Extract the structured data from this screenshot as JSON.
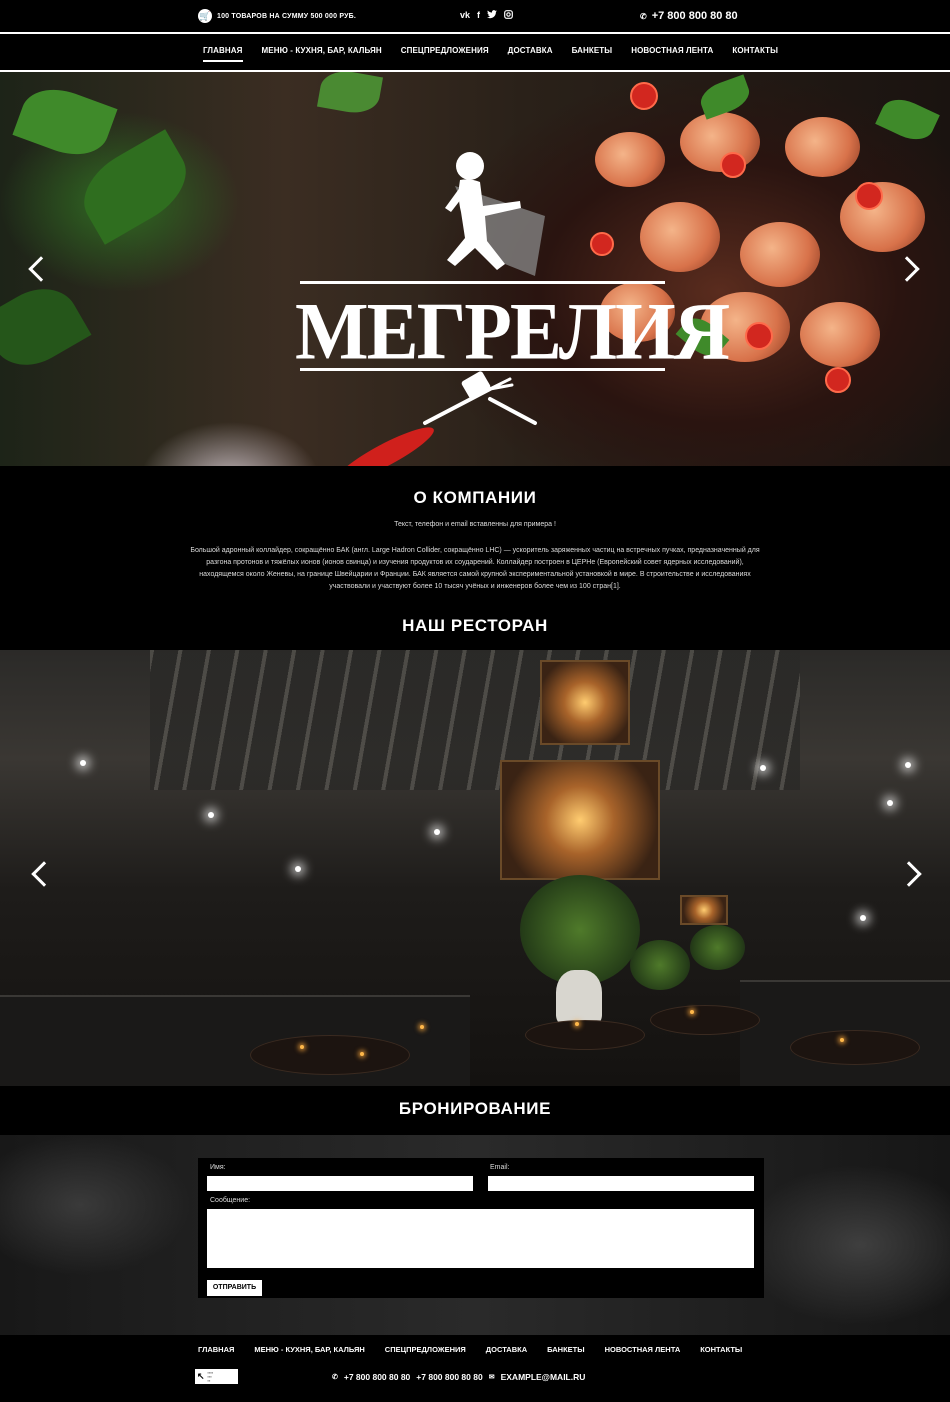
{
  "topbar": {
    "cart_text": "100 товаров на сумму 500 000 руб.",
    "socials": [
      {
        "icon": "vk-icon",
        "glyph": "vk"
      },
      {
        "icon": "facebook-icon",
        "glyph": "f"
      },
      {
        "icon": "twitter-icon",
        "glyph": "t"
      },
      {
        "icon": "instagram-icon",
        "glyph": "◎"
      }
    ],
    "phone": "+7 800 800 80 80"
  },
  "nav": {
    "items": [
      "Главная",
      "Меню - кухня, бар, кальян",
      "Спецпредложения",
      "Доставка",
      "Банкеты",
      "Новостная лента",
      "Контакты"
    ],
    "active_index": 0
  },
  "hero": {
    "logo_text": "МЕГРЕЛИЯ",
    "prev_icon": "chevron-left-icon",
    "next_icon": "chevron-right-icon"
  },
  "about": {
    "title": "О компании",
    "note": "Текст, телефон и email вставленны для примера !",
    "text": "Большой адронный коллайдер, сокращённо БАК (англ. Large Hadron Collider, сокращённо LHC) — ускоритель заряженных частиц на встречных пучках, предназначенный для разгона протонов и тяжёлых ионов (ионов свинца) и изучения продуктов их соударений. Коллайдер построен в ЦЕРНе (Европейский совет ядерных исследований), находящемся около Женевы, на границе Швейцарии и Франции. БАК является самой крупной экспериментальной установкой в мире. В строительстве и исследованиях участвовали и участвуют более 10 тысяч учёных и инженеров более чем из 100 стран[1]."
  },
  "restaurant": {
    "title": "Наш ресторан"
  },
  "booking": {
    "title": "Бронирование",
    "name_label": "Имя:",
    "email_label": "Email:",
    "message_label": "Сообщение:",
    "submit_label": "Отправить"
  },
  "footer": {
    "items": [
      "Главная",
      "Меню - кухня, бар, кальян",
      "Спецпредложения",
      "Доставка",
      "Банкеты",
      "Новостная лента",
      "Контакты"
    ],
    "phone1": "+7 800 800 80 80",
    "phone2": "+7 800 800 80 80",
    "email": "example@mail.ru"
  }
}
